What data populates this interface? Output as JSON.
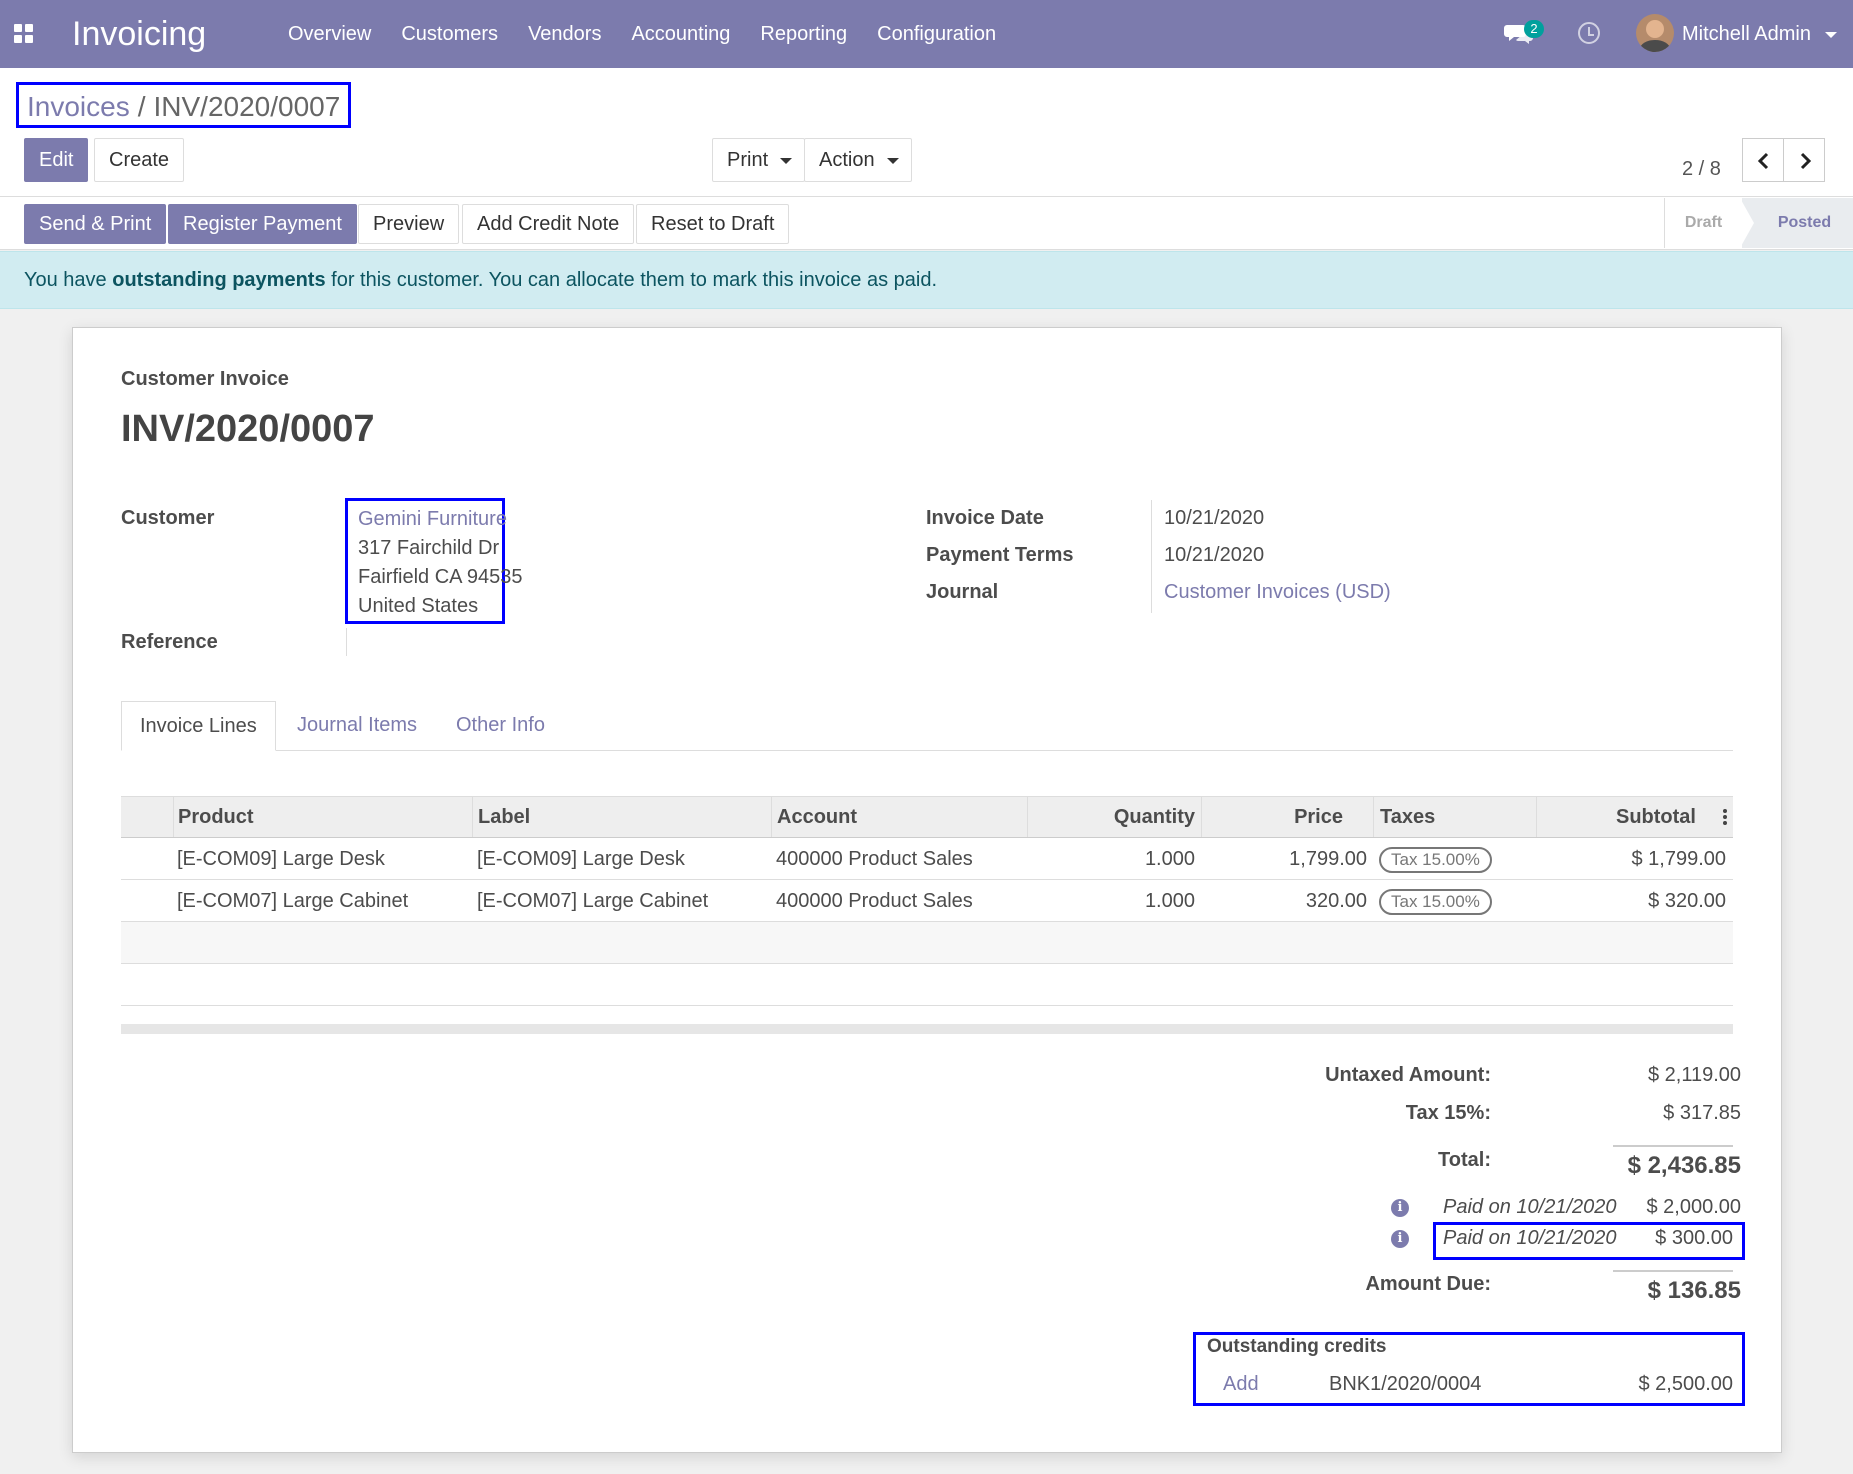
{
  "navbar": {
    "app_title": "Invoicing",
    "menu": [
      "Overview",
      "Customers",
      "Vendors",
      "Accounting",
      "Reporting",
      "Configuration"
    ],
    "chat_count": "2",
    "user_name": "Mitchell Admin",
    "color": "#7c7bad"
  },
  "breadcrumb": {
    "parent": "Invoices",
    "separator": "/",
    "current": "INV/2020/0007"
  },
  "buttons": {
    "edit": "Edit",
    "create": "Create",
    "print": "Print",
    "action": "Action",
    "send_print": "Send & Print",
    "register_payment": "Register Payment",
    "preview": "Preview",
    "add_credit_note": "Add Credit Note",
    "reset_to_draft": "Reset to Draft"
  },
  "pager": {
    "value": "2 / 8"
  },
  "status": {
    "draft": "Draft",
    "posted": "Posted",
    "active": "Posted"
  },
  "alert": {
    "prefix": "You have ",
    "bold": "outstanding payments",
    "suffix": " for this customer. You can allocate them to mark this invoice as paid."
  },
  "invoice": {
    "doc_type": "Customer Invoice",
    "number": "INV/2020/0007",
    "fields": {
      "customer_label": "Customer",
      "customer_name": "Gemini Furniture",
      "address": [
        "317 Fairchild Dr",
        "Fairfield CA 94535",
        "United States"
      ],
      "reference_label": "Reference",
      "reference_value": "",
      "invoice_date_label": "Invoice Date",
      "invoice_date": "10/21/2020",
      "payment_terms_label": "Payment Terms",
      "payment_terms": "10/21/2020",
      "journal_label": "Journal",
      "journal": "Customer Invoices (USD)"
    }
  },
  "tabs": [
    "Invoice Lines",
    "Journal Items",
    "Other Info"
  ],
  "lines": {
    "headers": [
      "Product",
      "Label",
      "Account",
      "Quantity",
      "Price",
      "Taxes",
      "Subtotal"
    ],
    "rows": [
      {
        "product": "[E-COM09] Large Desk",
        "label": "[E-COM09] Large Desk",
        "account": "400000 Product Sales",
        "quantity": "1.000",
        "price": "1,799.00",
        "tax": "Tax 15.00%",
        "subtotal": "$ 1,799.00"
      },
      {
        "product": "[E-COM07] Large Cabinet",
        "label": "[E-COM07] Large Cabinet",
        "account": "400000 Product Sales",
        "quantity": "1.000",
        "price": "320.00",
        "tax": "Tax 15.00%",
        "subtotal": "$ 320.00"
      }
    ]
  },
  "totals": {
    "untaxed_label": "Untaxed Amount:",
    "untaxed": "$ 2,119.00",
    "tax_label": "Tax 15%:",
    "tax": "$ 317.85",
    "total_label": "Total:",
    "total": "$ 2,436.85",
    "payments": [
      {
        "label": "Paid on 10/21/2020",
        "amount": "$ 2,000.00"
      },
      {
        "label": "Paid on 10/21/2020",
        "amount": "$ 300.00"
      }
    ],
    "amount_due_label": "Amount Due:",
    "amount_due": "$ 136.85"
  },
  "outstanding": {
    "title": "Outstanding credits",
    "items": [
      {
        "action": "Add",
        "ref": "BNK1/2020/0004",
        "amount": "$ 2,500.00"
      }
    ]
  }
}
